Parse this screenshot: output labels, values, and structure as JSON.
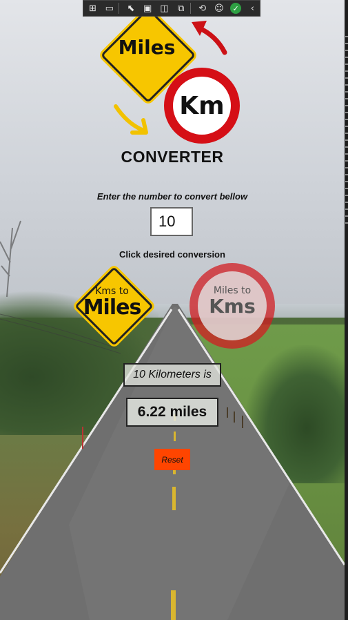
{
  "toolbar": {
    "icons": [
      "live-tree-icon",
      "device-toolbar-icon",
      "select-element-icon",
      "display-layout-adorners-icon",
      "track-focused-element-icon",
      "hot-reload-icon",
      "accessibility-checker-icon",
      "binding-failures-ok-icon",
      "collapse-toolbar-icon"
    ],
    "check_color": "#2ea043"
  },
  "header": {
    "miles_sign_text": "Miles",
    "km_sign_text": "Km",
    "title": "CONVERTER"
  },
  "form": {
    "prompt": "Enter the number to convert bellow",
    "input_value": "10",
    "click_label": "Click desired conversion"
  },
  "buttons": {
    "kms_to_miles": {
      "line1": "Kms to",
      "line2": "Miles"
    },
    "miles_to_kms": {
      "line1": "Miles to",
      "line2": "Kms"
    },
    "reset": "Reset"
  },
  "result": {
    "label": "10 Kilometers is",
    "value": "6.22 miles"
  },
  "colors": {
    "sign_yellow": "#f7c600",
    "sign_red": "#d50f16",
    "reset_orange": "#ff4500"
  }
}
